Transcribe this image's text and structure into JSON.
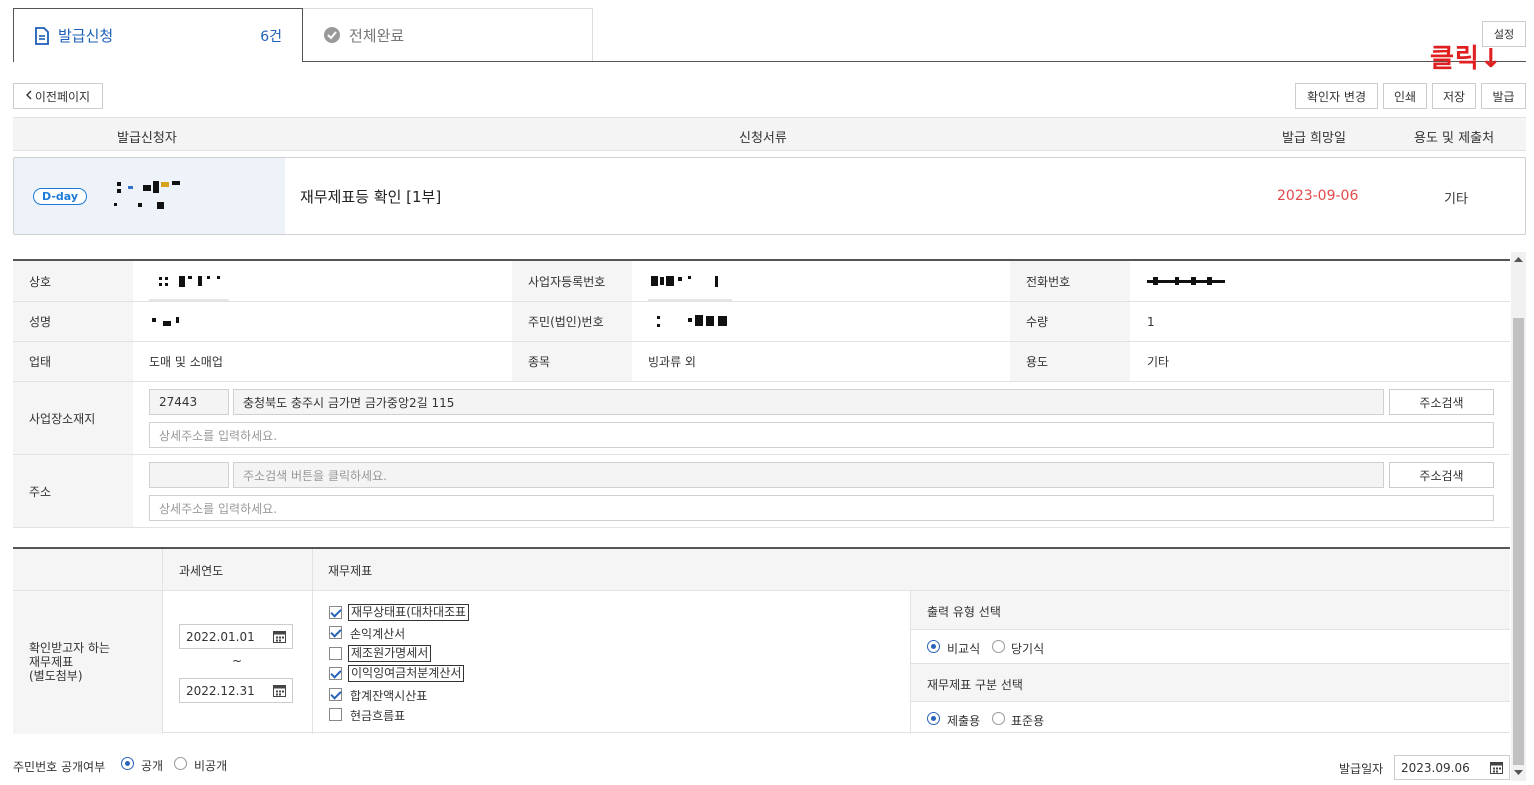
{
  "tabs": [
    {
      "label": "발급신청",
      "count": "6건",
      "icon": "document-icon"
    },
    {
      "label": "전체완료",
      "icon": "check-circle-icon"
    }
  ],
  "settings_label": "설정",
  "annotation": "클릭↓",
  "toolbar": {
    "back_label": "이전페이지",
    "change_checker_label": "확인자 변경",
    "print_label": "인쇄",
    "save_label": "저장",
    "issue_label": "발급"
  },
  "list_header": {
    "applicant": "발급신청자",
    "documents": "신청서류",
    "desired_date": "발급 희망일",
    "purpose": "용도 및 제출처"
  },
  "list_row": {
    "badge": "D-day",
    "document": "재무제표등 확인 [1부]",
    "desired_date": "2023-09-06",
    "purpose": "기타"
  },
  "info": {
    "company_label": "상호",
    "biz_no_label": "사업자등록번호",
    "phone_label": "전화번호",
    "name_label": "성명",
    "resident_no_label": "주민(법인)번호",
    "quantity_label": "수량",
    "quantity": "1",
    "business_type_label": "업태",
    "business_type": "도매 및 소매업",
    "item_label": "종목",
    "item": "빙과류 외",
    "purpose_label": "용도",
    "purpose": "기타",
    "workplace_label": "사업장소재지",
    "workplace_zip": "27443",
    "workplace_address": "충청북도 충주시 금가면 금가중앙2길 115",
    "search_address_label": "주소검색",
    "detail_placeholder": "상세주소를 입력하세요.",
    "address_label": "주소",
    "address_placeholder": "주소검색 버튼을 클릭하세요."
  },
  "statements": {
    "year_header": "과세연도",
    "statement_header": "재무제표",
    "row_label_1": "확인받고자 하는",
    "row_label_2": "재무제표",
    "row_label_3": "(별도첨부)",
    "date_from": "2022.01.01",
    "date_sep": "~",
    "date_to": "2022.12.31",
    "items": [
      {
        "label": "재무상태표(대차대조표",
        "checked": true
      },
      {
        "label": "손익계산서",
        "checked": true
      },
      {
        "label": "제조원가명세서",
        "checked": false
      },
      {
        "label": "이익잉여금처분계산서",
        "checked": true
      },
      {
        "label": "합계잔액시산표",
        "checked": true
      },
      {
        "label": "현금흐름표",
        "checked": false
      }
    ],
    "output_type_title": "출력 유형 선택",
    "output_options": [
      {
        "label": "비교식",
        "selected": true
      },
      {
        "label": "당기식",
        "selected": false
      }
    ],
    "category_title": "재무제표 구분 선택",
    "category_options": [
      {
        "label": "제출용",
        "selected": true
      },
      {
        "label": "표준용",
        "selected": false
      }
    ]
  },
  "footer": {
    "disclosure_label": "주민번호 공개여부",
    "disclosure_options": [
      {
        "label": "공개",
        "selected": true
      },
      {
        "label": "비공개",
        "selected": false
      }
    ],
    "issue_date_label": "발급일자",
    "issue_date": "2023.09.06"
  }
}
